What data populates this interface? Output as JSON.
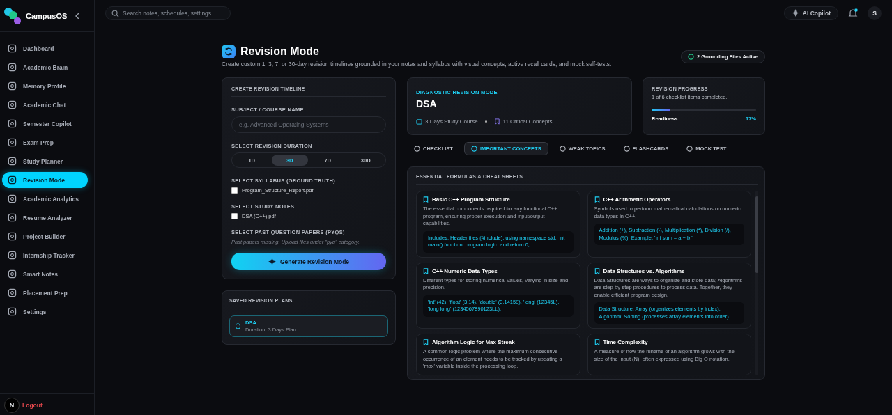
{
  "brand": {
    "name": "CampusOS"
  },
  "sidebar": {
    "items": [
      {
        "label": "Dashboard",
        "selected": false
      },
      {
        "label": "Academic Brain",
        "selected": false
      },
      {
        "label": "Memory Profile",
        "selected": false
      },
      {
        "label": "Academic Chat",
        "selected": false
      },
      {
        "label": "Semester Copilot",
        "selected": false
      },
      {
        "label": "Exam Prep",
        "selected": false
      },
      {
        "label": "Study Planner",
        "selected": false
      },
      {
        "label": "Revision Mode",
        "selected": true
      },
      {
        "label": "Academic Analytics",
        "selected": false
      },
      {
        "label": "Resume Analyzer",
        "selected": false
      },
      {
        "label": "Project Builder",
        "selected": false
      },
      {
        "label": "Internship Tracker",
        "selected": false
      },
      {
        "label": "Smart Notes",
        "selected": false
      },
      {
        "label": "Placement Prep",
        "selected": false
      },
      {
        "label": "Settings",
        "selected": false
      }
    ],
    "avatar": "N",
    "logout": "Logout"
  },
  "topbar": {
    "search_placeholder": "Search notes, schedules, settings...",
    "copilot": "AI Copilot",
    "user_initial": "S"
  },
  "header": {
    "title": "Revision Mode",
    "subtitle": "Create custom 1, 3, 7, or 30-day revision timelines grounded in your notes and syllabus with visual concepts, active recall cards, and mock self-tests.",
    "badge": "2 Grounding Files Active"
  },
  "form": {
    "title": "CREATE REVISION TIMELINE",
    "subject_label": "SUBJECT / COURSE NAME",
    "subject_placeholder": "e.g. Advanced Operating Systems",
    "duration_label": "SELECT REVISION DURATION",
    "durations": [
      {
        "label": "1D",
        "selected": false
      },
      {
        "label": "3D",
        "selected": true
      },
      {
        "label": "7D",
        "selected": false
      },
      {
        "label": "30D",
        "selected": false
      }
    ],
    "syllabus_label": "SELECT SYLLABUS (GROUND TRUTH)",
    "syllabus_files": [
      {
        "name": "Program_Structure_Report.pdf",
        "checked": false
      }
    ],
    "notes_label": "SELECT STUDY NOTES",
    "notes_files": [
      {
        "name": "DSA (C++).pdf",
        "checked": false
      }
    ],
    "pyq_label": "SELECT PAST QUESTION PAPERS (PYQS)",
    "pyq_note": "Past papers missing. Upload files under \"pyq\" category.",
    "generate_button": "Generate Revision Mode"
  },
  "saved": {
    "title": "SAVED REVISION PLANS",
    "plans": [
      {
        "name": "DSA",
        "detail": "Duration: 3 Days Plan"
      }
    ]
  },
  "course": {
    "eyebrow": "DIAGNOSTIC REVISION MODE",
    "title": "DSA",
    "duration": "3 Days Study Course",
    "concepts": "11 Critical Concepts"
  },
  "progress": {
    "title": "REVISION PROGRESS",
    "summary": "1 of 6 checklist items completed.",
    "level": 0.17,
    "label": "Readiness",
    "percent": "17%"
  },
  "tabs": [
    {
      "label": "CHECKLIST",
      "selected": false
    },
    {
      "label": "IMPORTANT CONCEPTS",
      "selected": true
    },
    {
      "label": "WEAK TOPICS",
      "selected": false
    },
    {
      "label": "FLASHCARDS",
      "selected": false
    },
    {
      "label": "MOCK TEST",
      "selected": false
    }
  ],
  "concepts_panel": {
    "title": "ESSENTIAL FORMULAS & CHEAT SHEETS",
    "cards": [
      {
        "title": "Basic C++ Program Structure",
        "description": "The essential components required for any functional C++ program, ensuring proper execution and input/output capabilities.",
        "detail": "Includes: Header files (#include), using namespace std;, int main() function, program logic, and return 0;."
      },
      {
        "title": "C++ Arithmetic Operators",
        "description": "Symbols used to perform mathematical calculations on numeric data types in C++.",
        "detail": "Addition (+), Subtraction (-), Multiplication (*), Division (/), Modulus (%). Example: 'int sum = a + b;'"
      },
      {
        "title": "C++ Numeric Data Types",
        "description": "Different types for storing numerical values, varying in size and precision.",
        "detail": "'int' (42), 'float' (3.14), 'double' (3.14159), 'long' (12345L), 'long long' (1234567890123LL)."
      },
      {
        "title": "Data Structures vs. Algorithms",
        "description": "Data Structures are ways to organize and store data; Algorithms are step-by-step procedures to process data. Together, they enable efficient program design.",
        "detail": "Data Structure: Array (organizes elements by index). Algorithm: Sorting (processes array elements into order)."
      },
      {
        "title": "Algorithm Logic for Max Streak",
        "description": "A common logic problem where the maximum consecutive occurrence of an element needs to be tracked by updating a 'max' variable inside the processing loop."
      },
      {
        "title": "Time Complexity",
        "description": "A measure of how the runtime of an algorithm grows with the size of the input (N), often expressed using Big O notation."
      }
    ]
  }
}
